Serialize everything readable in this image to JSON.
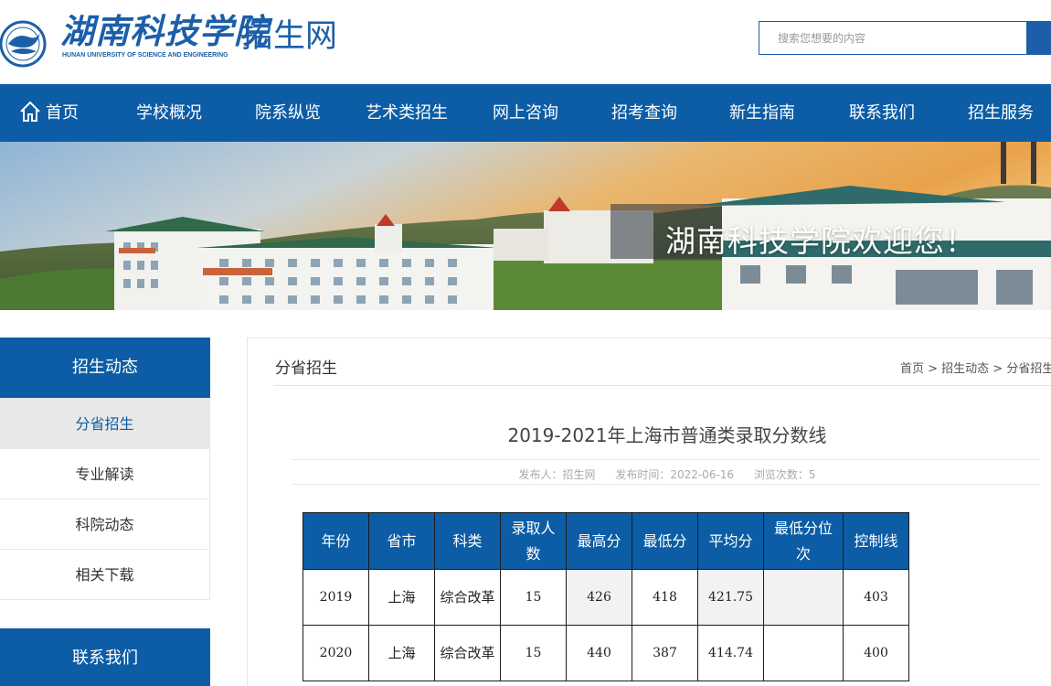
{
  "header": {
    "logo_cn": "湖南科技学院",
    "logo_en": "HUNAN UNIVERSITY OF SCIENCE AND ENGINEERING",
    "site_name": "招生网",
    "search_placeholder": "搜索您想要的内容"
  },
  "nav": {
    "items": [
      "首页",
      "学校概况",
      "院系纵览",
      "艺术类招生",
      "网上咨询",
      "招考查询",
      "新生指南",
      "联系我们",
      "招生服务"
    ]
  },
  "banner": {
    "text": "湖南科技学院欢迎您！"
  },
  "sidebar": {
    "title": "招生动态",
    "items": [
      "分省招生",
      "专业解读",
      "科院动态",
      "相关下载"
    ],
    "active_index": 0,
    "contact_title": "联系我们"
  },
  "content": {
    "section_title": "分省招生",
    "breadcrumb": "首页 > 招生动态 > 分省招生",
    "article_title": "2019-2021年上海市普通类录取分数线",
    "meta": {
      "publisher": "发布人：招生网",
      "publish_time": "发布时间：2022-06-16",
      "views": "浏览次数：5"
    },
    "table": {
      "headers": [
        "年份",
        "省市",
        "科类",
        "录取人数",
        "最高分",
        "最低分",
        "平均分",
        "最低分位次",
        "控制线"
      ],
      "rows": [
        [
          "2019",
          "上海",
          "综合改革",
          "15",
          "426",
          "418",
          "421.75",
          "",
          "403"
        ],
        [
          "2020",
          "上海",
          "综合改革",
          "15",
          "440",
          "387",
          "414.74",
          "",
          "400"
        ]
      ]
    }
  },
  "colors": {
    "brand_blue": "#0c5da5",
    "logo_blue": "#1c5fa8"
  }
}
